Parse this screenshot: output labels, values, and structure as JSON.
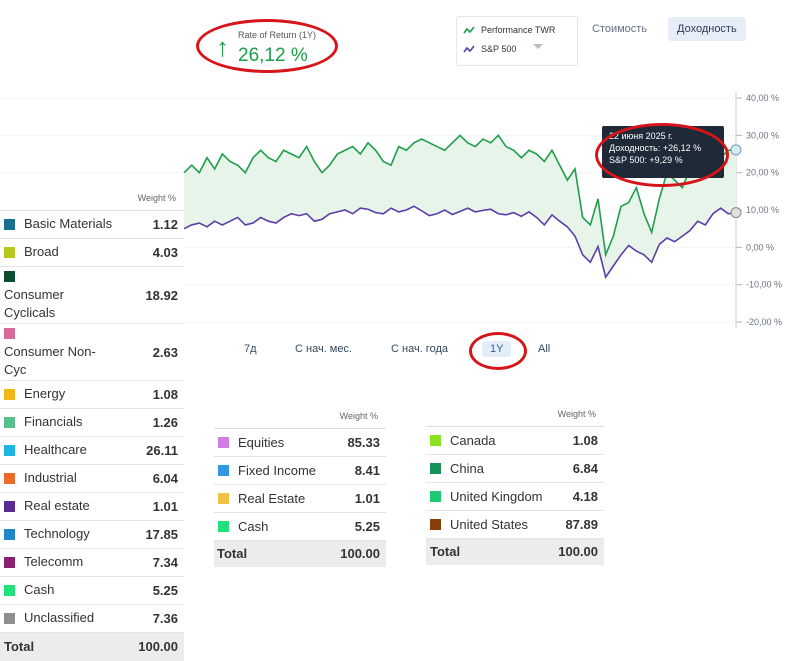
{
  "header": {
    "ror_title": "Rate of Return (1Y)",
    "ror_value": "26,12 %",
    "ror_arrow": "↑"
  },
  "legend": {
    "items": [
      {
        "label": "Performance TWR",
        "color": "#1e9e4a"
      },
      {
        "label": "S&P 500",
        "color": "#5b3ea6"
      }
    ]
  },
  "view_tabs": [
    {
      "label": "Стоимость",
      "active": false
    },
    {
      "label": "Доходность",
      "active": true
    }
  ],
  "chart_data": {
    "type": "line",
    "y_ticks": [
      "40,00 %",
      "30,00 %",
      "20,00 %",
      "10,00 %",
      "0,00 %",
      "-10,00 %",
      "-20,00 %"
    ],
    "ylim": [
      -20,
      40
    ],
    "series": [
      {
        "name": "Performance TWR",
        "color": "#1e9e4a",
        "values": [
          20,
          22,
          20,
          24,
          21,
          25,
          23,
          22,
          20,
          24,
          26,
          24,
          23,
          26,
          25,
          24,
          27,
          23,
          20,
          22,
          25,
          26,
          27,
          25,
          28,
          26,
          23,
          22,
          27,
          26,
          28,
          29,
          28,
          27,
          26,
          28,
          30,
          28,
          27,
          29,
          28,
          30,
          27,
          26,
          24,
          26,
          25,
          23,
          26,
          22,
          18,
          21,
          8,
          6,
          13,
          -2,
          3,
          11,
          12,
          16,
          9,
          4,
          13,
          20,
          18,
          16,
          21,
          22,
          24,
          25,
          24,
          26,
          26.1
        ]
      },
      {
        "name": "S&P 500",
        "color": "#5b3ea6",
        "values": [
          5,
          6,
          6.5,
          5.5,
          7,
          6,
          7,
          8,
          6,
          6.5,
          8,
          7,
          6.5,
          8,
          9,
          8.5,
          9,
          7,
          7.5,
          9,
          9.5,
          10,
          9,
          10.5,
          10.2,
          9.3,
          9,
          10.5,
          9.5,
          10,
          11,
          9.8,
          8.5,
          9,
          10,
          8.8,
          9.6,
          10.5,
          9.5,
          9.9,
          10.2,
          9,
          8.7,
          9.3,
          8.3,
          9.5,
          8,
          6,
          8.7,
          7,
          5.5,
          3,
          -2,
          -4,
          0.2,
          -8,
          -5,
          -2,
          0.5,
          -1,
          -2,
          -4,
          0.8,
          2.5,
          1.5,
          3,
          4.5,
          7,
          6,
          9,
          10.5,
          9,
          9.3
        ]
      }
    ]
  },
  "tooltip": {
    "date": "22 июня 2025 г.",
    "yield": "Доходность: +26,12 %",
    "sp": "S&P 500: +9,29 %"
  },
  "periods": [
    {
      "label": "7д",
      "active": false
    },
    {
      "label": "С нач. мес.",
      "active": false
    },
    {
      "label": "С нач. года",
      "active": false
    },
    {
      "label": "1Y",
      "active": true
    },
    {
      "label": "All",
      "active": false
    }
  ],
  "sectors": {
    "header": "Weight %",
    "rows": [
      {
        "name": "Basic Materials",
        "value": "1.12",
        "color": "#1a6f8f"
      },
      {
        "name": "Broad",
        "value": "4.03",
        "color": "#b7c71c"
      },
      {
        "name": "Consumer Cyclicals",
        "value": "18.92",
        "color": "#0d4d2f"
      },
      {
        "name": "Consumer Non-Cyc",
        "value": "2.63",
        "color": "#d86a97"
      },
      {
        "name": "Energy",
        "value": "1.08",
        "color": "#f0b814"
      },
      {
        "name": "Financials",
        "value": "1.26",
        "color": "#58c08a"
      },
      {
        "name": "Healthcare",
        "value": "26.11",
        "color": "#1cb6e0"
      },
      {
        "name": "Industrial",
        "value": "6.04",
        "color": "#ec6a2a"
      },
      {
        "name": "Real estate",
        "value": "1.01",
        "color": "#5b2a8e"
      },
      {
        "name": "Technology",
        "value": "17.85",
        "color": "#1f86c8"
      },
      {
        "name": "Telecomm",
        "value": "7.34",
        "color": "#8a2070"
      },
      {
        "name": "Cash",
        "value": "5.25",
        "color": "#22e07a"
      },
      {
        "name": "Unclassified",
        "value": "7.36",
        "color": "#8f8f8f"
      }
    ],
    "total_label": "Total",
    "total_value": "100.00"
  },
  "assets": {
    "header": "Weight %",
    "rows": [
      {
        "name": "Equities",
        "value": "85.33",
        "color": "#d17fe6"
      },
      {
        "name": "Fixed Income",
        "value": "8.41",
        "color": "#2f9ae3"
      },
      {
        "name": "Real Estate",
        "value": "1.01",
        "color": "#f2c246"
      },
      {
        "name": "Cash",
        "value": "5.25",
        "color": "#22e07a"
      }
    ],
    "total_label": "Total",
    "total_value": "100.00"
  },
  "regions": {
    "header": "Weight %",
    "rows": [
      {
        "name": "Canada",
        "value": "1.08",
        "color": "#8be21e"
      },
      {
        "name": "China",
        "value": "6.84",
        "color": "#16915a"
      },
      {
        "name": "United Kingdom",
        "value": "4.18",
        "color": "#1fc873"
      },
      {
        "name": "United States",
        "value": "87.89",
        "color": "#8a3d0c"
      }
    ],
    "total_label": "Total",
    "total_value": "100.00"
  }
}
